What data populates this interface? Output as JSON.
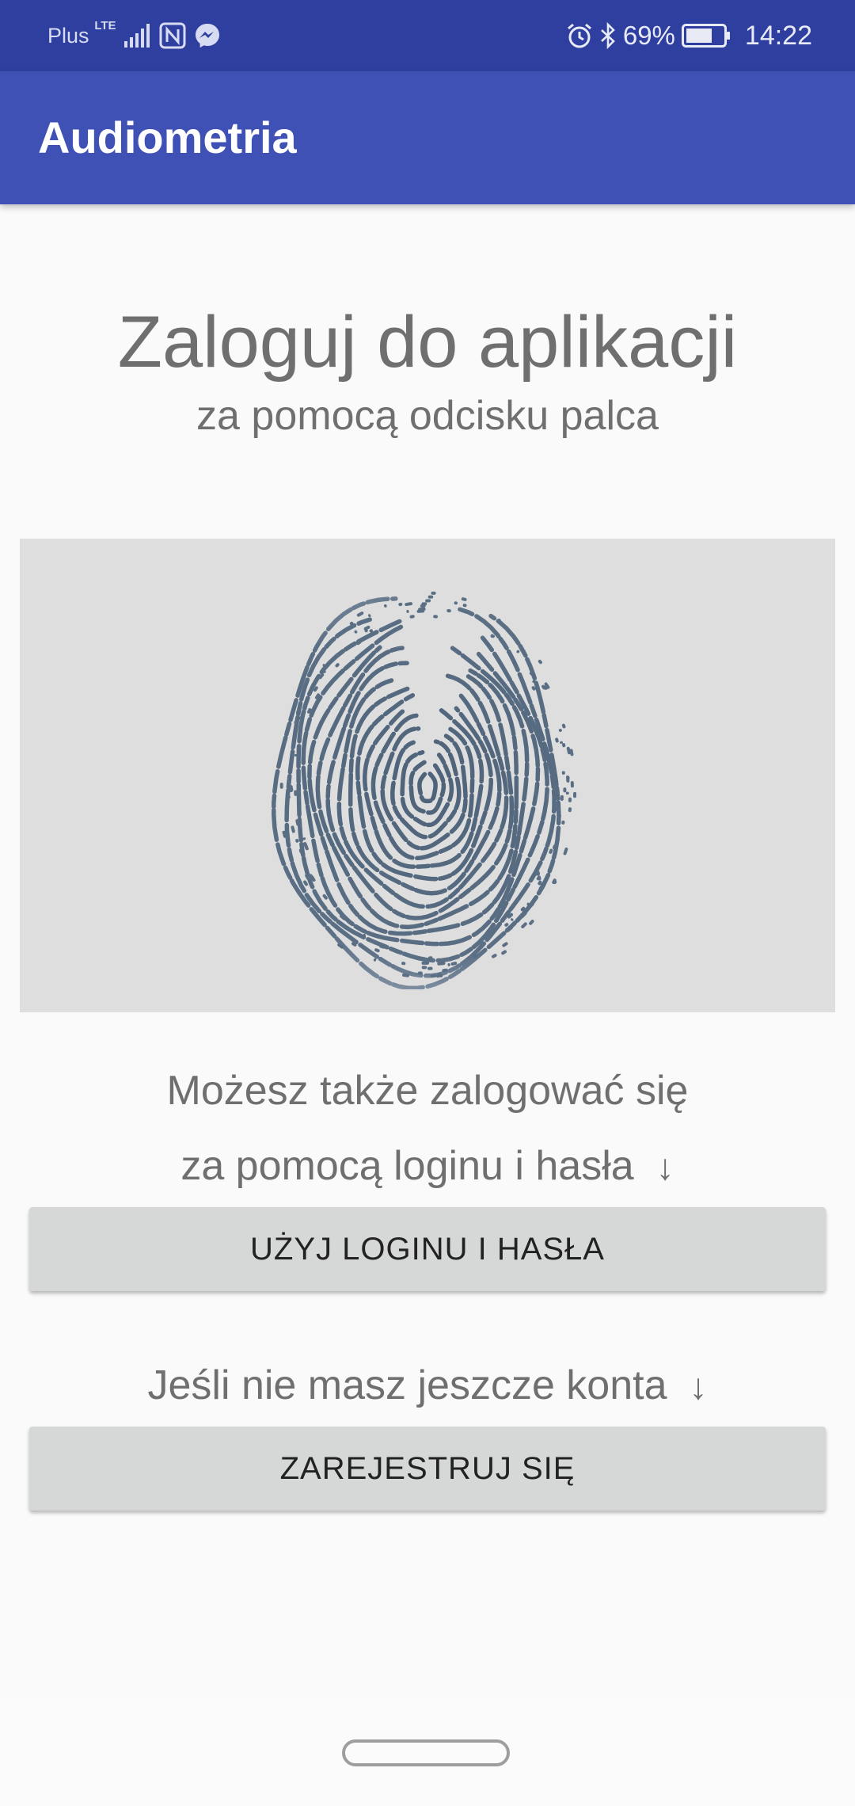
{
  "status_bar": {
    "carrier": "Plus",
    "network": "LTE",
    "battery": "69%",
    "time": "14:22",
    "icons": [
      "signal-icon",
      "nfc-icon",
      "messenger-icon",
      "alarm-icon",
      "bluetooth-icon",
      "battery-icon"
    ]
  },
  "app_bar": {
    "title": "Audiometria"
  },
  "login": {
    "headline": "Zaloguj do aplikacji",
    "subheadline": "za pomocą odcisku palca",
    "fingerprint_icon": "fingerprint-icon"
  },
  "alternative": {
    "line1": "Możesz także zalogować się",
    "line2": "za pomocą loginu i hasła",
    "arrow": "↓",
    "button_label": "UŻYJ LOGINU I HASŁA"
  },
  "register": {
    "prompt": "Jeśli nie masz jeszcze konta",
    "arrow": "↓",
    "button_label": "ZAREJESTRUJ SIĘ"
  },
  "colors": {
    "status_bar": "#2f3f9f",
    "app_bar": "#3f51b5",
    "text_gray": "#6f6f6f",
    "fingerprint": "#5a6e84",
    "button_bg": "#d6d7d7"
  }
}
